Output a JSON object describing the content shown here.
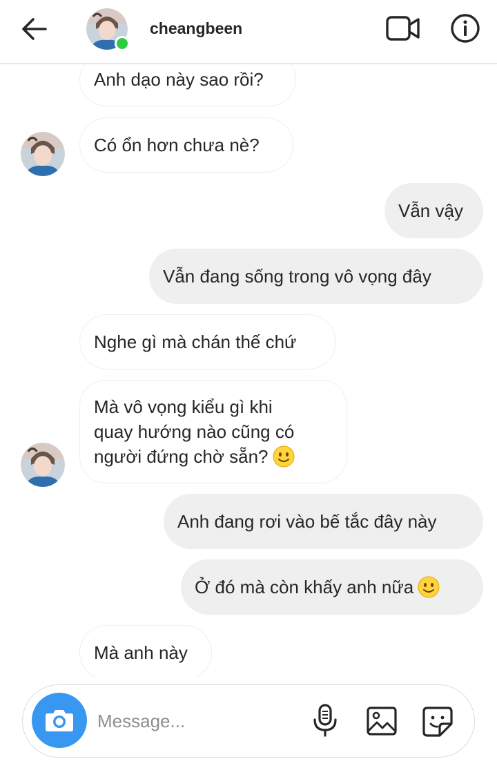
{
  "header": {
    "username": "cheangbeen",
    "online": true
  },
  "messages": [
    {
      "side": "in",
      "lines": [
        "Anh dạo này sao rồi?"
      ],
      "emoji": false
    },
    {
      "side": "in",
      "lines": [
        "Có ổn hơn chưa nè?"
      ],
      "emoji": false,
      "avatar": true
    },
    {
      "side": "out",
      "lines": [
        "Vẫn vậy"
      ],
      "emoji": false
    },
    {
      "side": "out",
      "lines": [
        "Vẫn đang sống trong vô vọng đây"
      ],
      "emoji": false
    },
    {
      "side": "in",
      "lines": [
        "Nghe gì mà chán thế chứ"
      ],
      "emoji": false
    },
    {
      "side": "in",
      "lines": [
        "Mà vô vọng kiểu gì khi",
        "quay hướng nào cũng có",
        "người đứng chờ sẵn?"
      ],
      "emoji": true,
      "avatar": true
    },
    {
      "side": "out",
      "lines": [
        "Anh đang rơi vào bế tắc đây này"
      ],
      "emoji": false
    },
    {
      "side": "out",
      "lines": [
        "Ở đó mà còn khấy anh nữa"
      ],
      "emoji": true
    },
    {
      "side": "in",
      "lines": [
        "Mà anh này"
      ],
      "emoji": false
    }
  ],
  "composer": {
    "placeholder": "Message..."
  },
  "icons": {
    "back": "arrow-left-icon",
    "video": "video-camera-icon",
    "info": "info-circle-icon",
    "camera": "camera-icon",
    "mic": "microphone-icon",
    "gallery": "image-gallery-icon",
    "sticker": "sticker-icon",
    "emoji": "slightly-smiling-face-emoji"
  },
  "colors": {
    "accent": "#3897f0",
    "online": "#2ecc40",
    "outgoing_bubble": "#efefef",
    "incoming_border": "#efefef",
    "text": "#262626",
    "placeholder": "#8e8e8e"
  }
}
